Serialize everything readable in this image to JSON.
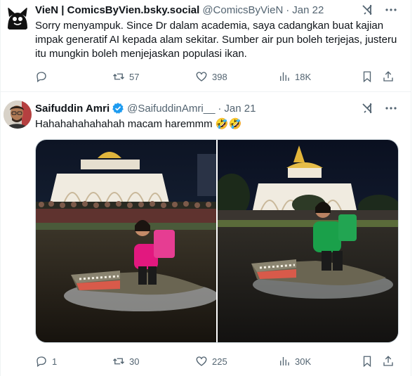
{
  "tweets": [
    {
      "display_name": "VieN | ComicsByVien.bsky.social",
      "handle": "@ComicsByVieN",
      "separator": "·",
      "date": "Jan 22",
      "text": "Sorry menyampuk. Since Dr dalam academia, saya cadangkan buat kajian impak generatif AI kepada alam sekitar. Sumber air pun boleh terjejas, justeru itu mungkin boleh menjejaskan populasi ikan.",
      "stats": {
        "replies": "",
        "reposts": "57",
        "likes": "398",
        "views": "18K"
      }
    },
    {
      "display_name": "Saifuddin Amri",
      "handle": "@SaifuddinAmri__",
      "separator": "·",
      "date": "Jan 21",
      "text": "Hahahahahahahah macam haremmm 🤣🤣",
      "verified": true,
      "stats": {
        "replies": "1",
        "reposts": "30",
        "likes": "225",
        "views": "30K"
      },
      "photos": [
        {
          "rider_shirt_text": "food\npanda",
          "shirt_color": "#e2187f",
          "bag_color": "#e2187f"
        },
        {
          "rider_shirt_text": "Grab",
          "shirt_color": "#1aa04a",
          "bag_color": "#1aa04a"
        }
      ]
    }
  ],
  "icons": [
    "reply-icon",
    "repost-icon",
    "like-icon",
    "views-icon",
    "bookmark-icon",
    "share-icon",
    "grok-icon",
    "more-icon"
  ],
  "colors": {
    "text": "#0f1419",
    "secondary": "#536471",
    "border": "#eff3f4",
    "verified": "#1d9bf0"
  }
}
